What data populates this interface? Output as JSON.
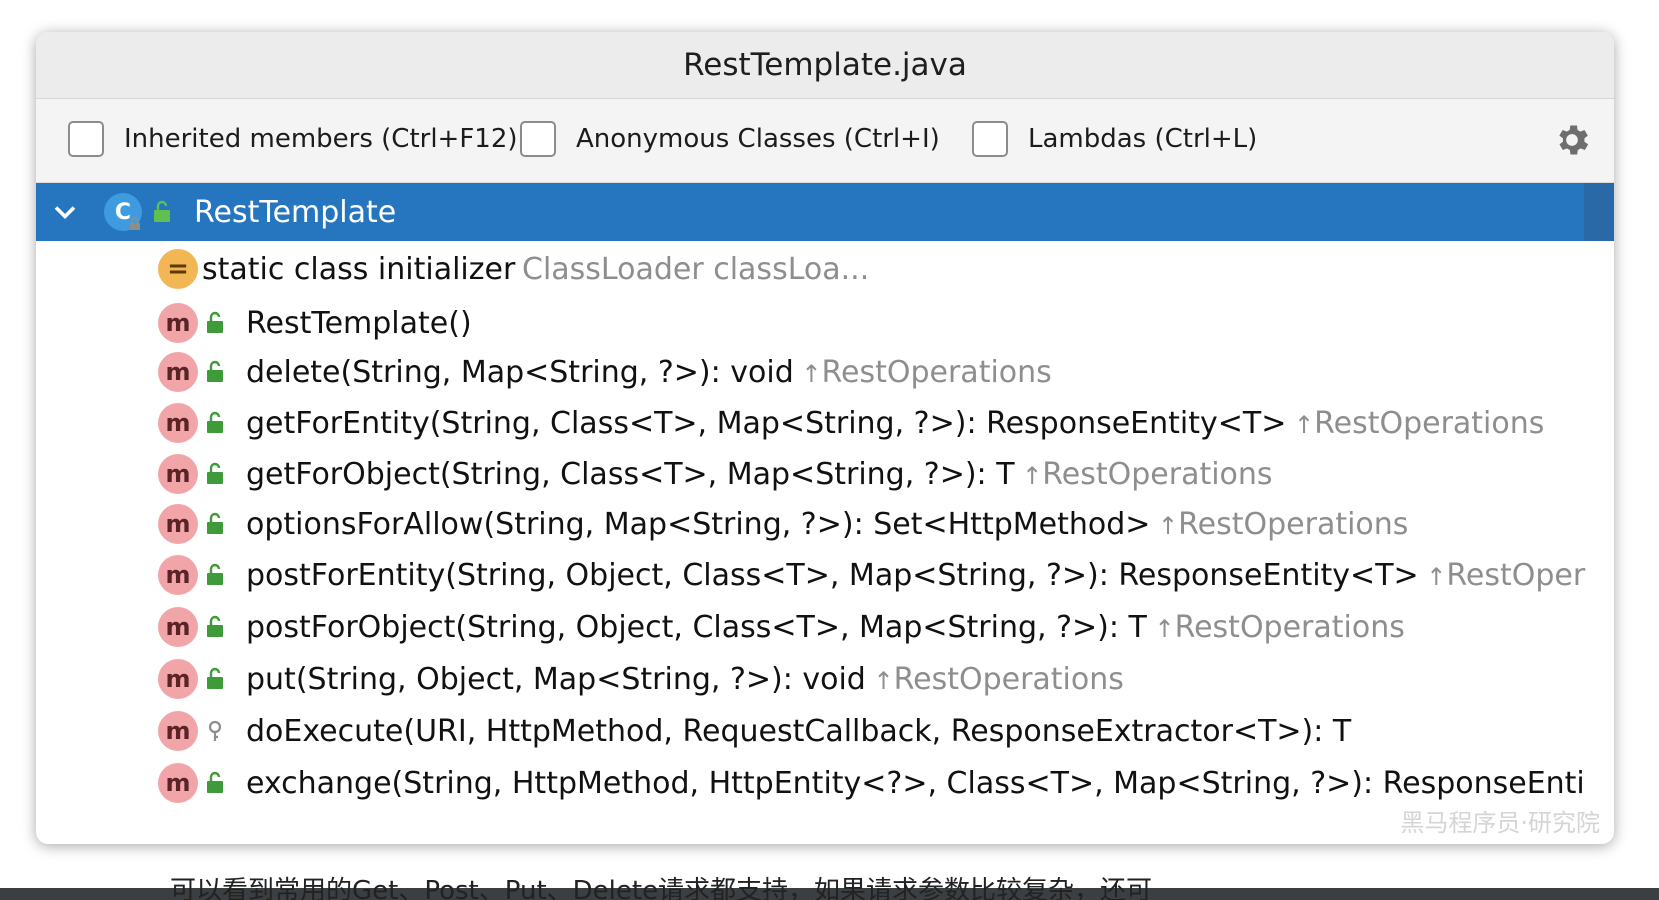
{
  "background": {
    "top_text": "• • • • •",
    "bottom_text": "可以看到常用的Get、Post、Put、Delete请求都支持，如果请求参数比较复杂，还可"
  },
  "popup": {
    "title": "RestTemplate.java",
    "options": [
      {
        "label": "Inherited members (Ctrl+F12)",
        "checked": false
      },
      {
        "label": "Anonymous Classes (Ctrl+I)",
        "checked": false
      },
      {
        "label": "Lambdas (Ctrl+L)",
        "checked": false
      }
    ],
    "settings_icon": "gear-icon",
    "watermark": "黑马程序员·研究院"
  },
  "tree": {
    "root": {
      "label": "RestTemplate",
      "icon": "class-icon",
      "expanded": true
    },
    "initializer": {
      "label": "static class initializer",
      "hint": "ClassLoader classLoa..."
    },
    "members": [
      {
        "signature": "RestTemplate()",
        "origin": "",
        "visibility": "public"
      },
      {
        "signature": "delete(String, Map<String, ?>): void",
        "origin": "RestOperations",
        "visibility": "public"
      },
      {
        "signature": "getForEntity(String, Class<T>, Map<String, ?>): ResponseEntity<T>",
        "origin": "RestOperations",
        "visibility": "public"
      },
      {
        "signature": "getForObject(String, Class<T>, Map<String, ?>): T",
        "origin": "RestOperations",
        "visibility": "public"
      },
      {
        "signature": "optionsForAllow(String, Map<String, ?>): Set<HttpMethod>",
        "origin": "RestOperations",
        "visibility": "public"
      },
      {
        "signature": "postForEntity(String, Object, Class<T>, Map<String, ?>): ResponseEntity<T>",
        "origin": "RestOper",
        "visibility": "public"
      },
      {
        "signature": "postForObject(String, Object, Class<T>, Map<String, ?>): T",
        "origin": "RestOperations",
        "visibility": "public"
      },
      {
        "signature": "put(String, Object, Map<String, ?>): void",
        "origin": "RestOperations",
        "visibility": "public"
      },
      {
        "signature": "doExecute(URI, HttpMethod, RequestCallback, ResponseExtractor<T>): T",
        "origin": "",
        "visibility": "protected"
      },
      {
        "signature": "exchange(String, HttpMethod, HttpEntity<?>, Class<T>, Map<String, ?>): ResponseEnti",
        "origin": "",
        "visibility": "public"
      }
    ],
    "member_badge": "m",
    "origin_arrow": "↑"
  },
  "colors": {
    "selection": "#2675bf",
    "method_badge": "#f2a5a8",
    "public_lock": "#3f9a3a",
    "hint_gray": "#8e8e8e"
  }
}
